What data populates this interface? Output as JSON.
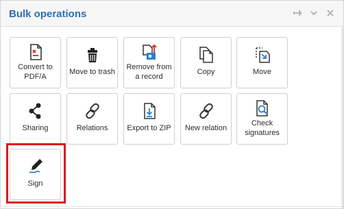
{
  "header": {
    "title": "Bulk operations"
  },
  "tiles": [
    {
      "label": "Convert to PDF/A",
      "icon": "pdf-convert-icon"
    },
    {
      "label": "Move to trash",
      "icon": "trash-icon"
    },
    {
      "label": "Remove from a record",
      "icon": "remove-from-record-icon"
    },
    {
      "label": "Copy",
      "icon": "copy-icon"
    },
    {
      "label": "Move",
      "icon": "move-icon"
    },
    {
      "label": "Sharing",
      "icon": "share-icon"
    },
    {
      "label": "Relations",
      "icon": "link-icon"
    },
    {
      "label": "Export to ZIP",
      "icon": "export-zip-icon"
    },
    {
      "label": "New relation",
      "icon": "link-icon"
    },
    {
      "label": "Check signatures",
      "icon": "check-signature-icon"
    },
    {
      "label": "Sign",
      "icon": "pen-icon"
    }
  ],
  "colors": {
    "accent": "#2f6fae",
    "highlight": "#e0121b",
    "icon_blue": "#2e7fd0",
    "icon_red": "#d9261c"
  }
}
